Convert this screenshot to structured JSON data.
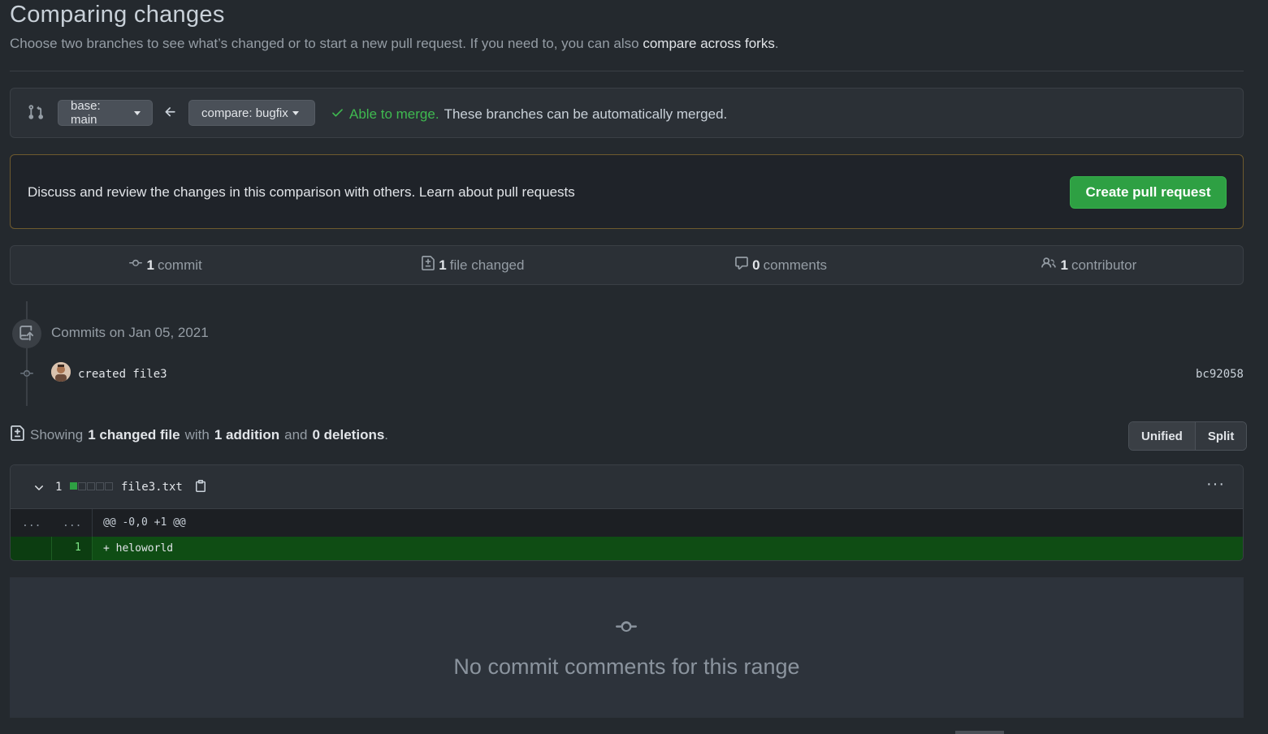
{
  "header": {
    "title": "Comparing changes",
    "subtitle": "Choose two branches to see what’s changed or to start a new pull request. If you need to, you can also",
    "subtitle_link": "compare across forks",
    "subtitle_end": "."
  },
  "range": {
    "base_label": "base: main",
    "compare_label": "compare: bugfix",
    "merge_status": "Able to merge.",
    "merge_desc": "These branches can be automatically merged."
  },
  "pr": {
    "text": "Discuss and review the changes in this comparison with others.",
    "learn_link": "Learn about pull requests",
    "button": "Create pull request"
  },
  "stats": {
    "commits_count": "1",
    "commits_label": "commit",
    "files_count": "1",
    "files_label": "file changed",
    "comments_count": "0",
    "comments_label": "comments",
    "contributors_count": "1",
    "contributors_label": "contributor"
  },
  "commits": {
    "date_heading": "Commits on Jan 05, 2021",
    "items": [
      {
        "message": "created file3",
        "sha": "bc92058"
      }
    ]
  },
  "summary": {
    "showing": "Showing",
    "changed": "1 changed file",
    "with": "with",
    "additions": "1 addition",
    "and": "and",
    "deletions": "0 deletions",
    "end": "."
  },
  "view_toggle": {
    "unified": "Unified",
    "split": "Split"
  },
  "file": {
    "change_count": "1",
    "name": "file3.txt",
    "more": "···",
    "hunk_left": "...",
    "hunk_right": "...",
    "hunk_header": "@@ -0,0 +1 @@",
    "line_number": "1",
    "line_content": "+ heloworld"
  },
  "empty_comments": {
    "text": "No commit comments for this range"
  },
  "colors": {
    "accent_green": "#2ea043",
    "ok_green": "#3fb950",
    "background": "#24292e"
  }
}
